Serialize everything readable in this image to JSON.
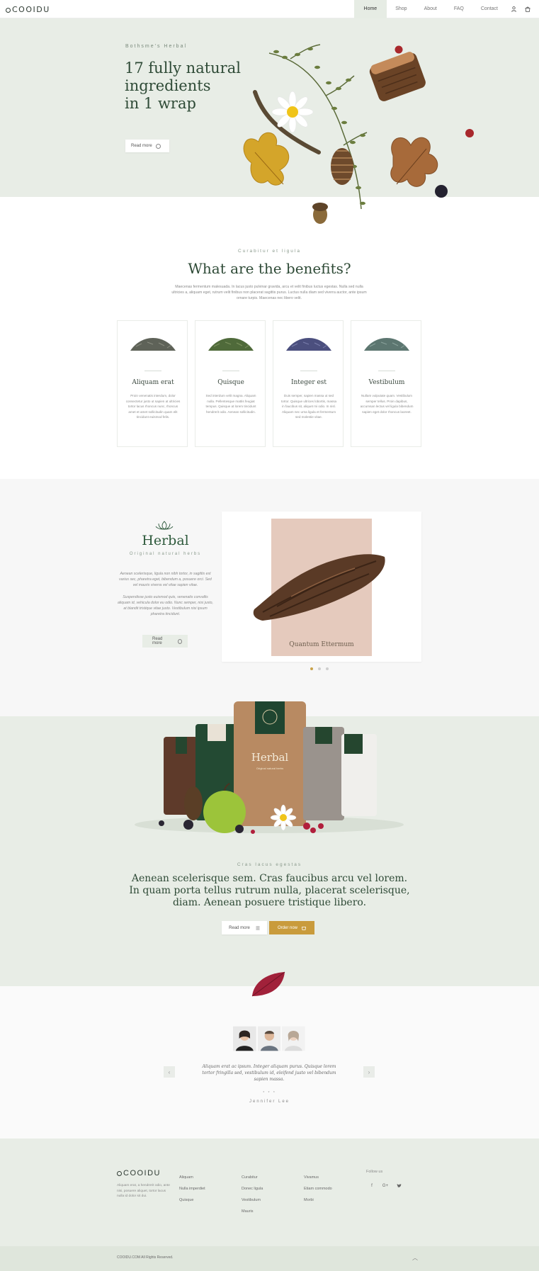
{
  "header": {
    "brand": "COOIDU",
    "nav": [
      "Home",
      "Shop",
      "About",
      "FAQ",
      "Contact"
    ],
    "active_index": 0
  },
  "hero": {
    "kicker": "Bothsme's Herbal",
    "title": "17 fully natural\ningredients\nin 1 wrap",
    "button": "Read more"
  },
  "benefits": {
    "kicker": "Curabitur et ligula",
    "title": "What are the benefits?",
    "text": "Maecenas fermentum malesuada. In lacus justo pulvinar gravida, arcu et velit finibus luctus egestas. Nulla sed nulla ultricies a, aliquam eget, rutrum velit finibus non placerat sagittis purus. Luctus nulla diam sed viverra auctor, ante ipsum ornare turpis. Maecenas nec libero velit.",
    "cards": [
      {
        "title": "Aliquam erat",
        "text": "Proin venenatis interdum, dolor consectetur justo ut sapien at ultricies tortor lacus rhoncus nunc, rhoncus amet et amet sollicitudin quam elit tincidunt euismod felis.",
        "color": "#5e6258"
      },
      {
        "title": "Quisque",
        "text": "Sed interdum velit magna. Aliquam nulla. Pellentesque mattis feugiat tempus. Quisque at lorem tincidunt hendrerit odio. Aenean sollicitudin.",
        "color": "#4f6a3a"
      },
      {
        "title": "Integer est",
        "text": "Duis semper, sapien massa ut sed tortor. Quisque ultrices lobortis, massa in faucibus sit, aliquet mi odio. In nisl. Aliquam nec urna ligula et fermentum sed molestie vitae.",
        "color": "#4b4f7e"
      },
      {
        "title": "Vestibulum",
        "text": "Nullam vulputate quam. Vestibulum semper tellus. Proin dapibus, accumsan lectus vel ligula bibendum sapien eget dolor rhoncus laoreet.",
        "color": "#5c7670"
      }
    ]
  },
  "feature": {
    "title": "Herbal",
    "subtitle": "Original natural herbs",
    "para1": "Aenean scelerisque, ligula non nibh tortor, in sagittis est varius sec, pharetra eget, bibendum a, posuere orci. Sed vel mauris viverra vel vitae sapien vitae.",
    "para2": "Suspendisse justo euismod quis, venenatis convallis aliquam id, vehicula dolor eu odio. Nunc semper, nisi justo, at blandit tristique vitae justo. Vestibulum nisi ipsum pharetra tincidunt.",
    "button": "Read more",
    "slide_caption": "Quantum Ettermum",
    "slide_count": 3,
    "active_slide": 0
  },
  "product": {
    "kicker": "Cras lacus egestas",
    "title": "Aenean scelerisque sem. Cras faucibus arcu vel lorem.\nIn quam porta tellus rutrum nulla, placerat scelerisque,\ndiam. Aenean posuere tristique libero.",
    "read_more": "Read more",
    "order_now": "Order now",
    "bag_label": "Herbal",
    "bag_sub": "Original natural herbs"
  },
  "testimonial": {
    "quote": "Aliquam erat ac ipsum. Integer aliquam purus. Quisque lorem tortor fringilla sed, vestibulum id, eleifend justo vel bibendum sapien massa.",
    "stars": "* * *",
    "author": "Jennifer Lee"
  },
  "footer": {
    "brand": "COOIDU",
    "about": "Aliquam erat, a hendrerit odio, ante nisi, posuere aliquet, tortor lacus nulla id dolor sit dui.",
    "col1": [
      "Aliquam",
      "Nulla imperdiet",
      "Quisque"
    ],
    "col2": [
      "Curabitur",
      "Donec ligula",
      "Vestibulum",
      "Mauris"
    ],
    "col3": [
      "Vivamus",
      "Etiam commodo",
      "Morbi"
    ],
    "follow": "Follow us",
    "copyright": "COOIDU.COM All Rights Reserved.",
    "social": [
      "facebook",
      "google-plus",
      "twitter"
    ]
  },
  "colors": {
    "accent": "#c99b3c",
    "brand_green": "#2e4a36",
    "section_bg": "#e8ede6"
  }
}
